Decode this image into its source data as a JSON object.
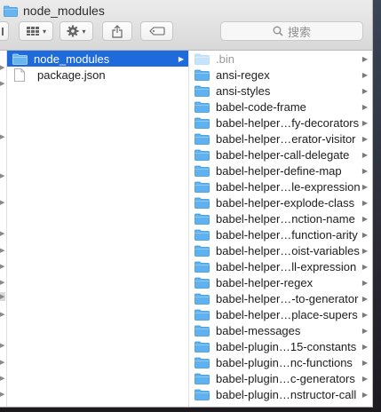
{
  "window": {
    "title": "node_modules"
  },
  "toolbar": {
    "search_placeholder": "搜索",
    "view_label": "▾",
    "action_label": "▾"
  },
  "colors": {
    "selection": "#1f6bdc",
    "folder": "#5fb2ef",
    "folder_dim": "#c5e3fa"
  },
  "column2": {
    "items": [
      {
        "label": "node_modules",
        "type": "folder",
        "selected": true
      },
      {
        "label": "package.json",
        "type": "file",
        "selected": false
      }
    ]
  },
  "column3": {
    "items": [
      {
        "label": ".bin",
        "dim": true
      },
      {
        "label": "ansi-regex"
      },
      {
        "label": "ansi-styles"
      },
      {
        "label": "babel-code-frame"
      },
      {
        "label": "babel-helper…fy-decorators"
      },
      {
        "label": "babel-helper…erator-visitor"
      },
      {
        "label": "babel-helper-call-delegate"
      },
      {
        "label": "babel-helper-define-map"
      },
      {
        "label": "babel-helper…le-expression"
      },
      {
        "label": "babel-helper-explode-class"
      },
      {
        "label": "babel-helper…nction-name"
      },
      {
        "label": "babel-helper…function-arity"
      },
      {
        "label": "babel-helper…oist-variables"
      },
      {
        "label": "babel-helper…ll-expression"
      },
      {
        "label": "babel-helper-regex"
      },
      {
        "label": "babel-helper…-to-generator"
      },
      {
        "label": "babel-helper…place-supers"
      },
      {
        "label": "babel-messages"
      },
      {
        "label": "babel-plugin…15-constants"
      },
      {
        "label": "babel-plugin…nc-functions"
      },
      {
        "label": "babel-plugin…c-generators"
      },
      {
        "label": "babel-plugin…nstructor-call"
      }
    ]
  }
}
